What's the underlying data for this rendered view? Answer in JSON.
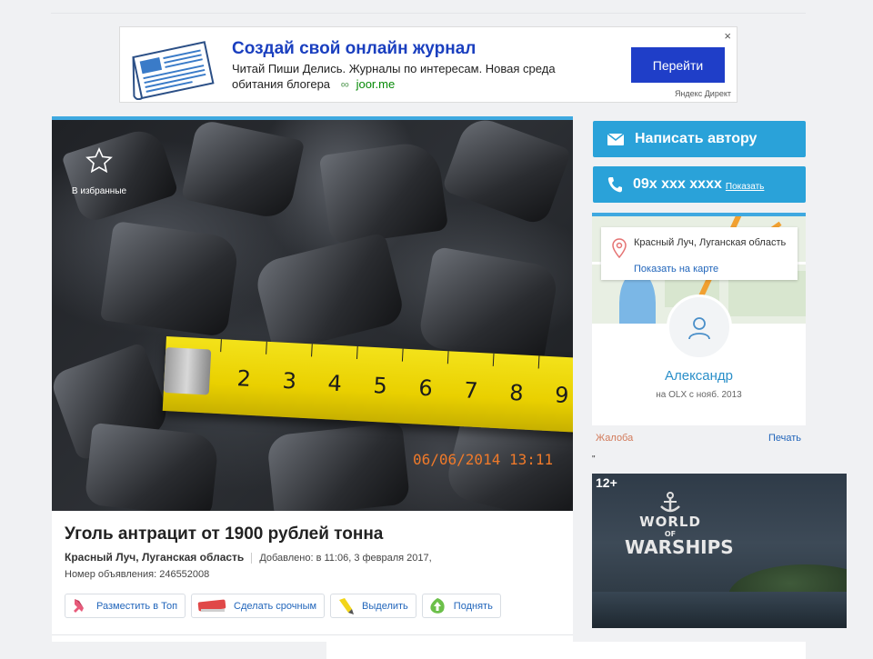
{
  "ad": {
    "title": "Создай свой онлайн журнал",
    "text": "Читай Пиши Делись. Журналы по интересам. Новая среда обитания блогера",
    "domain": "joor.me",
    "button": "Перейти",
    "close": "×",
    "source": "Яндекс Директ"
  },
  "listing": {
    "favorite_label": "В избранные",
    "photo_datestamp": "06/06/2014 13:11",
    "tape_numbers": [
      "2",
      "3",
      "4",
      "5",
      "6",
      "7",
      "8",
      "9"
    ],
    "title": "Уголь антрацит от 1900 рублей тонна",
    "location": "Красный Луч, Луганская область",
    "added": "Добавлено: в 11:06, 3 февраля 2017,",
    "ad_number": "Номер объявления: 246552008",
    "actions": [
      {
        "label": "Разместить в Топ",
        "icon": "rocket-icon"
      },
      {
        "label": "Сделать срочным",
        "icon": "urgent-badge-icon"
      },
      {
        "label": "Выделить",
        "icon": "highlighter-icon"
      },
      {
        "label": "Поднять",
        "icon": "raise-arrow-icon"
      }
    ]
  },
  "contact": {
    "write_author": "Написать автору",
    "phone": "09x xxx xxxx",
    "show_phone": "Показать"
  },
  "seller": {
    "address": "Красный Луч, Луганская область",
    "show_on_map": "Показать на карте",
    "name": "Александр",
    "since": "на OLX с нояб. 2013"
  },
  "links": {
    "complaint": "Жалоба",
    "print": "Печать",
    "quote": "\""
  },
  "banner": {
    "age_rating": "12+",
    "logo_line1": "WORLD",
    "logo_line2": "OF",
    "logo_line3": "WARSHIPS"
  },
  "colors": {
    "accent": "#2aa2d9",
    "ad_title": "#1a3fbf",
    "ad_button": "#1f3ec8",
    "link": "#2266bb",
    "complaint": "#d27a5a",
    "datestamp": "#f07a2a"
  }
}
